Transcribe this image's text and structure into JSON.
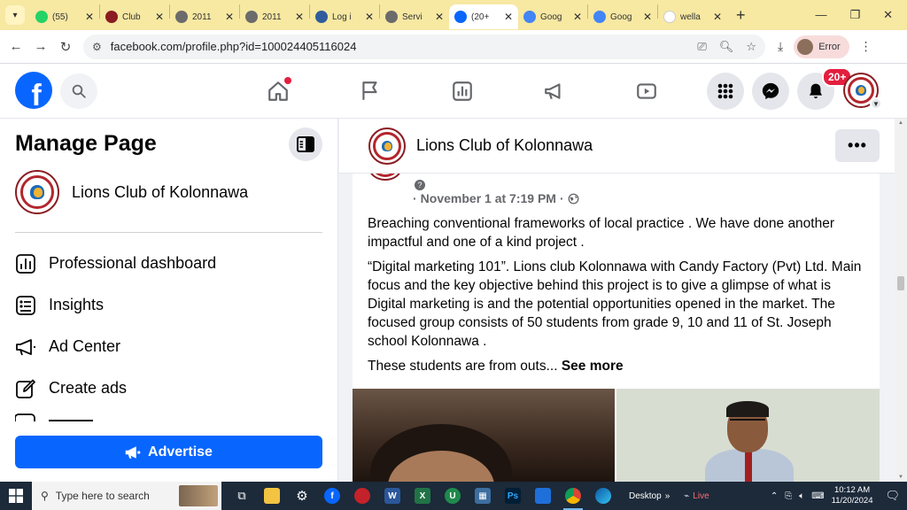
{
  "browser": {
    "tabs": [
      {
        "title": "(55)",
        "favicon": "whatsapp-icon",
        "color": "#25d366"
      },
      {
        "title": "Club",
        "favicon": "lions-icon",
        "color": "#8a1c22"
      },
      {
        "title": "2011",
        "favicon": "globe-icon",
        "color": "#6b6b6b"
      },
      {
        "title": "2011",
        "favicon": "globe-icon",
        "color": "#6b6b6b"
      },
      {
        "title": "Log i",
        "favicon": "lions-icon",
        "color": "#2f5d9c"
      },
      {
        "title": "Servi",
        "favicon": "globe-icon",
        "color": "#6b6b6b"
      },
      {
        "title": "(20+",
        "favicon": "facebook-icon",
        "color": "#0866ff"
      },
      {
        "title": "Goog",
        "favicon": "google-translate-icon",
        "color": "#4285f4"
      },
      {
        "title": "Goog",
        "favicon": "google-translate-icon",
        "color": "#4285f4"
      },
      {
        "title": "wella",
        "favicon": "google-icon",
        "color": "#ffffff"
      }
    ],
    "active_tab_index": 6,
    "url": "facebook.com/profile.php?id=100024405116024",
    "profile_label": "Error"
  },
  "fb": {
    "notifications_badge": "20+"
  },
  "sidebar": {
    "title": "Manage Page",
    "page_name": "Lions Club of Kolonnawa",
    "menu": [
      {
        "label": "Professional dashboard",
        "icon": "dashboard-icon"
      },
      {
        "label": "Insights",
        "icon": "insights-icon"
      },
      {
        "label": "Ad Center",
        "icon": "megaphone-icon"
      },
      {
        "label": "Create ads",
        "icon": "pencil-icon"
      }
    ],
    "advertise_label": "Advertise"
  },
  "main": {
    "page_name": "Lions Club of Kolonnawa",
    "post": {
      "date": "November 1 at 7:19 PM",
      "dot": "·",
      "paragraphs": [
        "Breaching conventional frameworks of local practice . We have done another impactful and one of a kind project .",
        "“Digital marketing 101”. Lions club Kolonnawa with Candy Factory (Pvt) Ltd. Main focus and the key objective behind this project is to give a glimpse of what is Digital marketing is and the potential opportunities opened in the market. The focused group consists of 50 students from grade 9, 10 and 11 of St. Joseph school Kolonnawa ."
      ],
      "truncated_text": "These students are from outs... ",
      "see_more_label": "See more"
    }
  },
  "taskbar": {
    "search_placeholder": "Type here to search",
    "desktop_label": "Desktop",
    "live_label": "Live",
    "time": "10:12 AM",
    "date": "11/20/2024"
  },
  "colors": {
    "fb_blue": "#0866ff",
    "chrome_frame": "#f7e8a2",
    "notification_red": "#e41e3f"
  }
}
